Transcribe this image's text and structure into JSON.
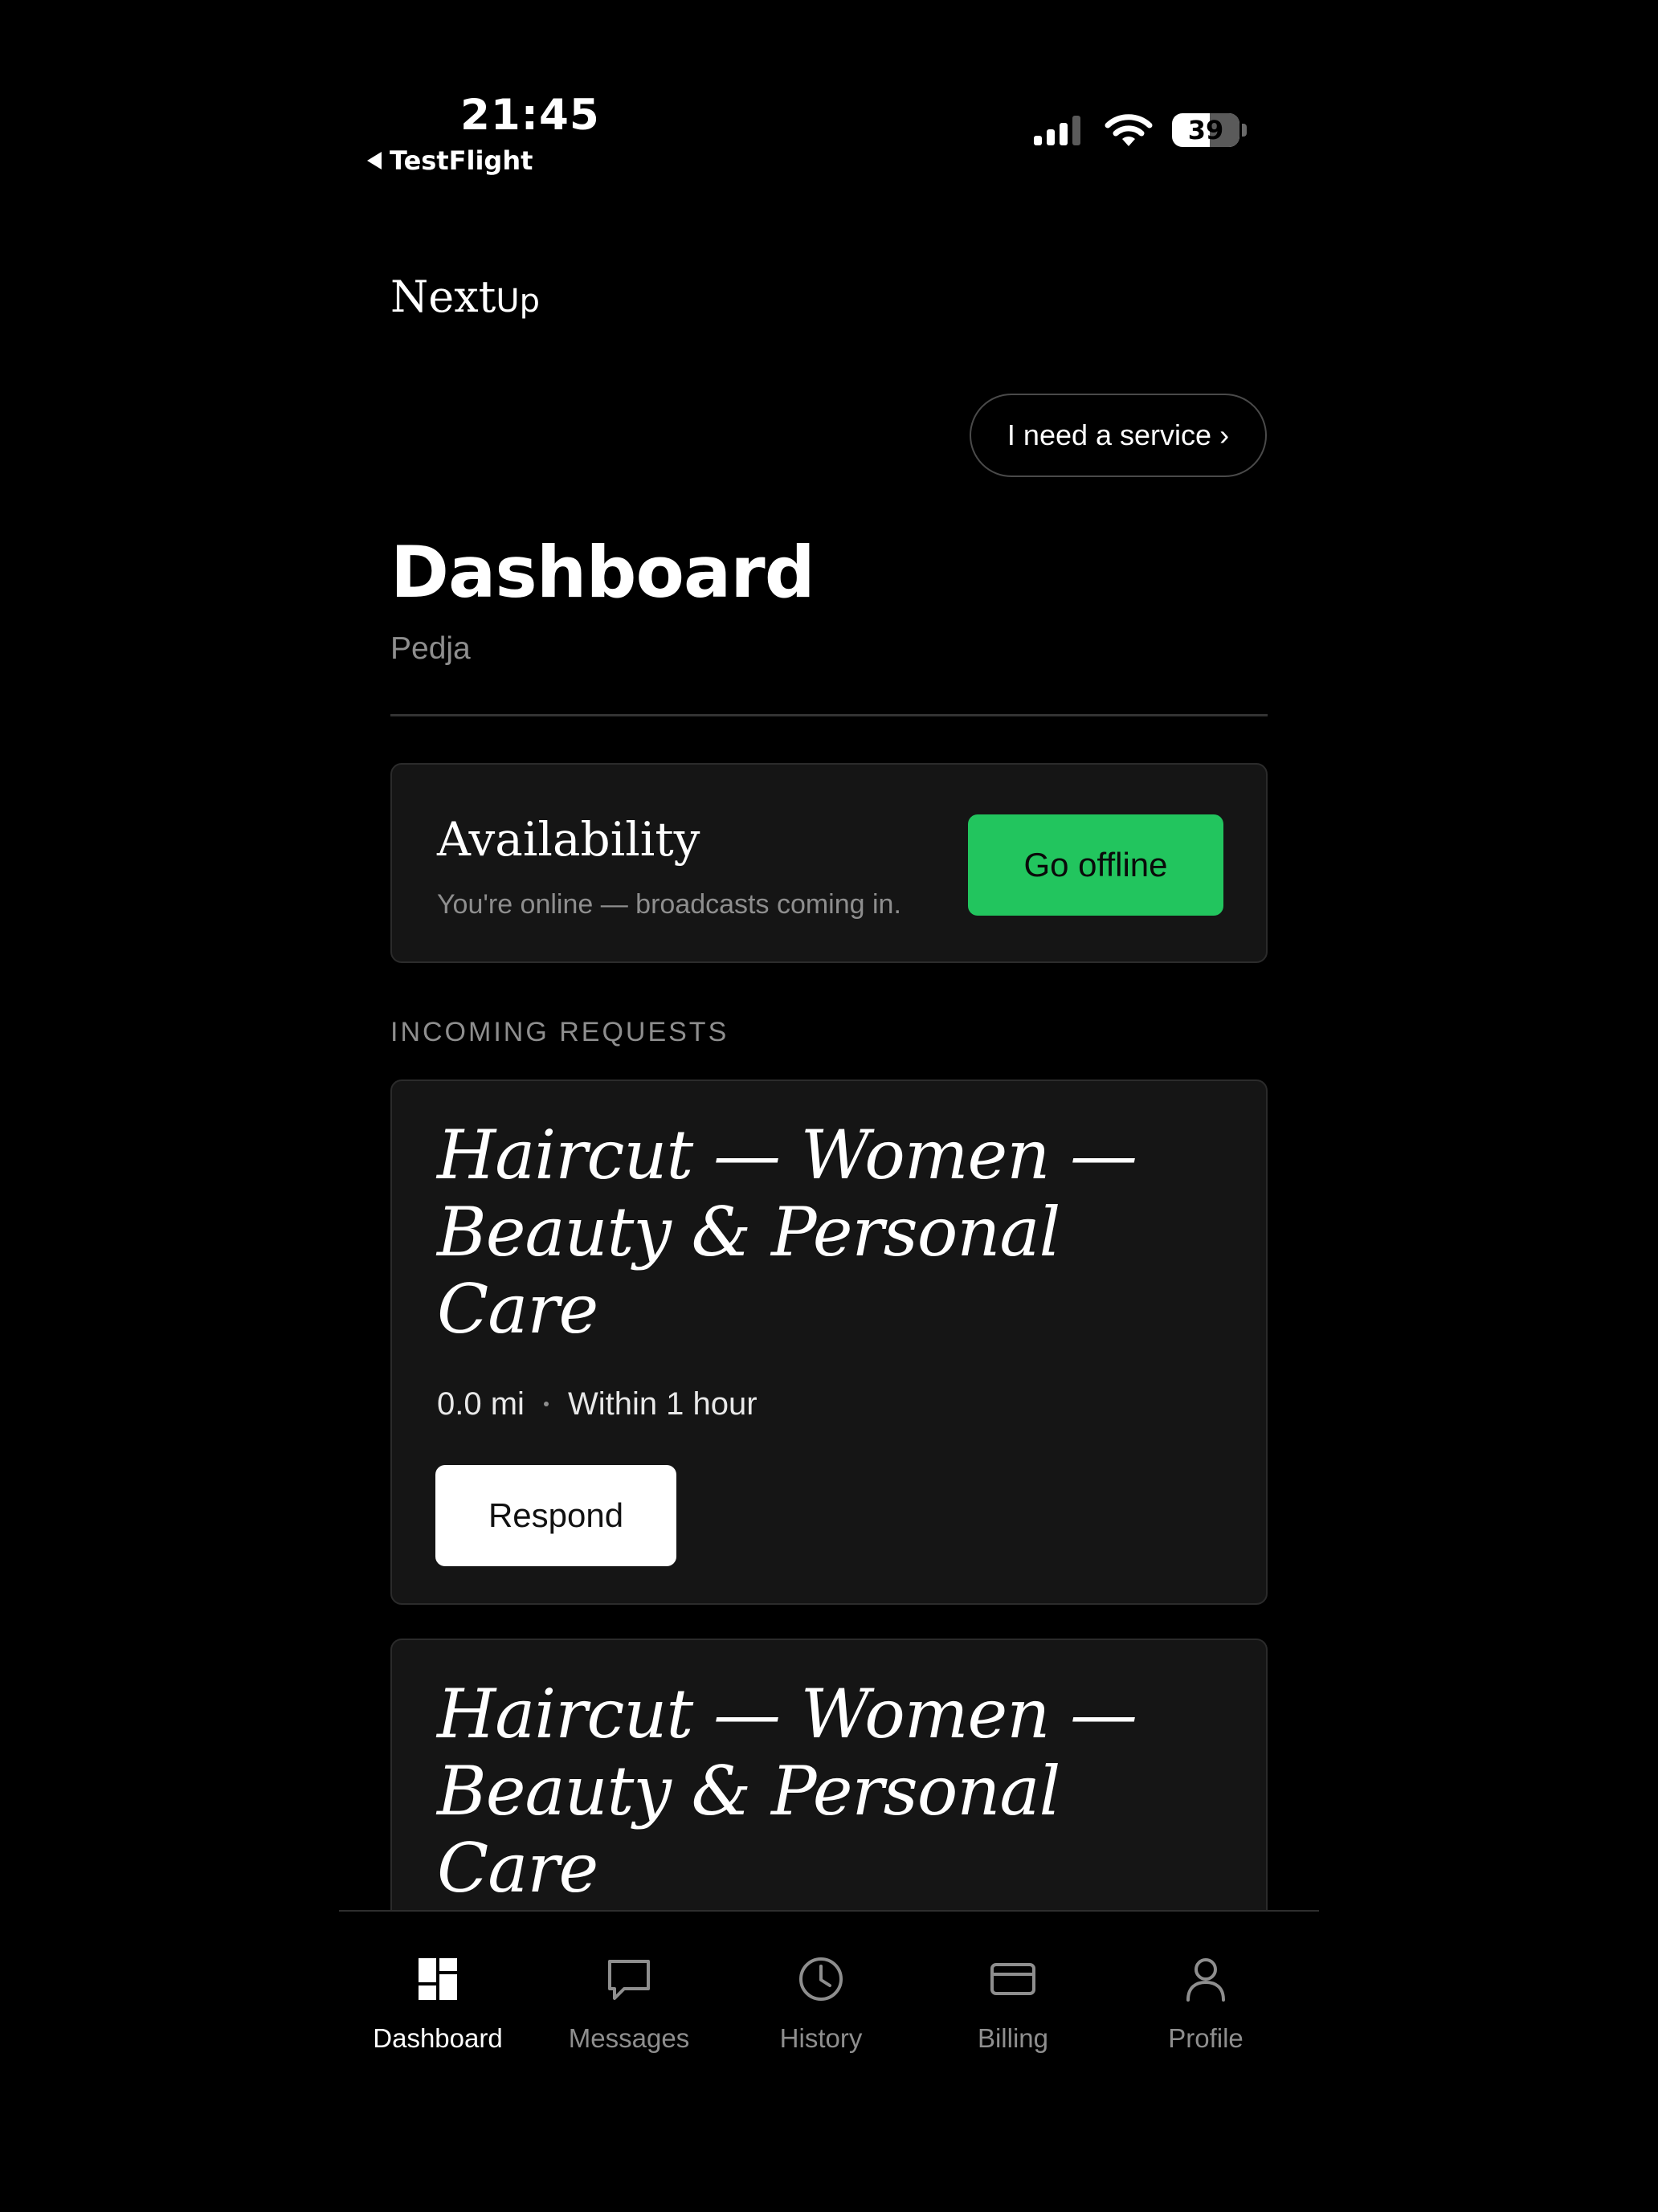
{
  "status_bar": {
    "time": "21:45",
    "back_app": "TestFlight",
    "battery": "39"
  },
  "header": {
    "logo_main": "Next",
    "logo_suffix": "Up",
    "service_button": "I need a service ›"
  },
  "page": {
    "title": "Dashboard",
    "subtitle": "Pedja"
  },
  "availability": {
    "title": "Availability",
    "description": "You're online — broadcasts coming in.",
    "button": "Go offline",
    "button_color": "#22c55e"
  },
  "requests": {
    "section_label": "INCOMING REQUESTS",
    "items": [
      {
        "title": "Haircut — Women — Beauty & Personal Care",
        "distance": "0.0 mi",
        "timing": "Within 1 hour",
        "action": "Respond"
      },
      {
        "title": "Haircut — Women — Beauty & Personal Care"
      }
    ]
  },
  "tabbar": {
    "items": [
      {
        "label": "Dashboard",
        "icon": "dashboard-icon",
        "active": true
      },
      {
        "label": "Messages",
        "icon": "chat-bubble-icon",
        "active": false
      },
      {
        "label": "History",
        "icon": "clock-icon",
        "active": false
      },
      {
        "label": "Billing",
        "icon": "credit-card-icon",
        "active": false
      },
      {
        "label": "Profile",
        "icon": "person-icon",
        "active": false
      }
    ]
  }
}
